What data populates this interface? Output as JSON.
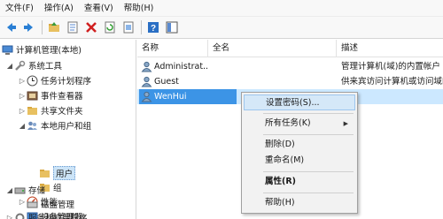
{
  "menubar": {
    "items": [
      "文件(F)",
      "操作(A)",
      "查看(V)",
      "帮助(H)"
    ]
  },
  "toolbar": {
    "buttons": [
      "back-icon",
      "forward-icon",
      "folder-icon",
      "properties-icon",
      "delete-icon",
      "refresh-icon",
      "export-icon",
      "help-icon",
      "panel-icon"
    ]
  },
  "tree": {
    "root": "计算机管理(本地)",
    "system_tools": "系统工具",
    "task_scheduler": "任务计划程序",
    "event_viewer": "事件查看器",
    "shared_folders": "共享文件夹",
    "local_users_groups": "本地用户和组",
    "users": "用户",
    "groups": "组",
    "performance": "性能",
    "device_manager": "设备管理器",
    "storage": "存储",
    "disk_management": "磁盘管理",
    "services_apps": "服务和应用程序"
  },
  "list": {
    "columns": [
      "名称",
      "全名",
      "描述"
    ],
    "rows": [
      {
        "name": "Administrat...",
        "fullname": "",
        "desc": "管理计算机(域)的内置帐户"
      },
      {
        "name": "Guest",
        "fullname": "",
        "desc": "供来宾访问计算机或访问域的..."
      },
      {
        "name": "WenHui",
        "fullname": "",
        "desc": ""
      }
    ]
  },
  "context_menu": {
    "set_password": "设置密码(S)...",
    "all_tasks": "所有任务(K)",
    "delete": "删除(D)",
    "rename": "重命名(M)",
    "properties": "属性(R)",
    "help": "帮助(H)"
  },
  "colors": {
    "selection_blue": "#3c94e6",
    "highlight_light": "#cce8ff",
    "menu_bg": "#f2f2f2"
  }
}
